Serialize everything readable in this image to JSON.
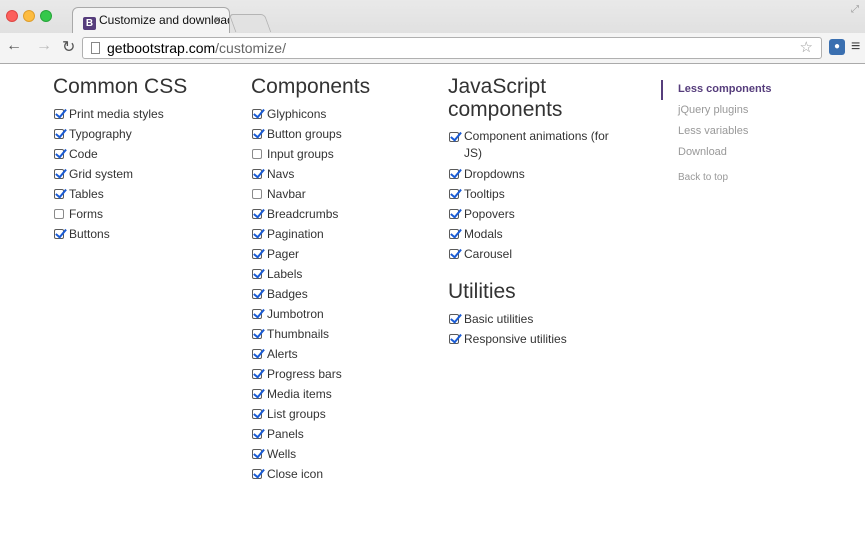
{
  "browser": {
    "tab_title": "Customize and download · ",
    "favicon_letter": "B",
    "tab_close": "×",
    "url_host": "getbootstrap.com",
    "url_path": "/customize/"
  },
  "columns": {
    "common_css": {
      "heading": "Common CSS",
      "items": [
        {
          "label": "Print media styles",
          "checked": true
        },
        {
          "label": "Typography",
          "checked": true
        },
        {
          "label": "Code",
          "checked": true
        },
        {
          "label": "Grid system",
          "checked": true
        },
        {
          "label": "Tables",
          "checked": true
        },
        {
          "label": "Forms",
          "checked": false
        },
        {
          "label": "Buttons",
          "checked": true
        }
      ]
    },
    "components": {
      "heading": "Components",
      "items": [
        {
          "label": "Glyphicons",
          "checked": true
        },
        {
          "label": "Button groups",
          "checked": true
        },
        {
          "label": "Input groups",
          "checked": false
        },
        {
          "label": "Navs",
          "checked": true
        },
        {
          "label": "Navbar",
          "checked": false
        },
        {
          "label": "Breadcrumbs",
          "checked": true
        },
        {
          "label": "Pagination",
          "checked": true
        },
        {
          "label": "Pager",
          "checked": true
        },
        {
          "label": "Labels",
          "checked": true
        },
        {
          "label": "Badges",
          "checked": true
        },
        {
          "label": "Jumbotron",
          "checked": true
        },
        {
          "label": "Thumbnails",
          "checked": true
        },
        {
          "label": "Alerts",
          "checked": true
        },
        {
          "label": "Progress bars",
          "checked": true
        },
        {
          "label": "Media items",
          "checked": true
        },
        {
          "label": "List groups",
          "checked": true
        },
        {
          "label": "Panels",
          "checked": true
        },
        {
          "label": "Wells",
          "checked": true
        },
        {
          "label": "Close icon",
          "checked": true
        }
      ]
    },
    "javascript": {
      "heading_line1": "JavaScript",
      "heading_line2": "components",
      "items": [
        {
          "label": "Component animations (for JS)",
          "checked": true
        },
        {
          "label": "Dropdowns",
          "checked": true
        },
        {
          "label": "Tooltips",
          "checked": true
        },
        {
          "label": "Popovers",
          "checked": true
        },
        {
          "label": "Modals",
          "checked": true
        },
        {
          "label": "Carousel",
          "checked": true
        }
      ]
    },
    "utilities": {
      "heading": "Utilities",
      "items": [
        {
          "label": "Basic utilities",
          "checked": true
        },
        {
          "label": "Responsive utilities",
          "checked": true
        }
      ]
    }
  },
  "sidenav": {
    "links": [
      "Less components",
      "jQuery plugins",
      "Less variables",
      "Download"
    ],
    "active_index": 0,
    "back_to_top": "Back to top"
  },
  "colors": {
    "accent": "#563d7c",
    "check": "#1a5bd4"
  }
}
